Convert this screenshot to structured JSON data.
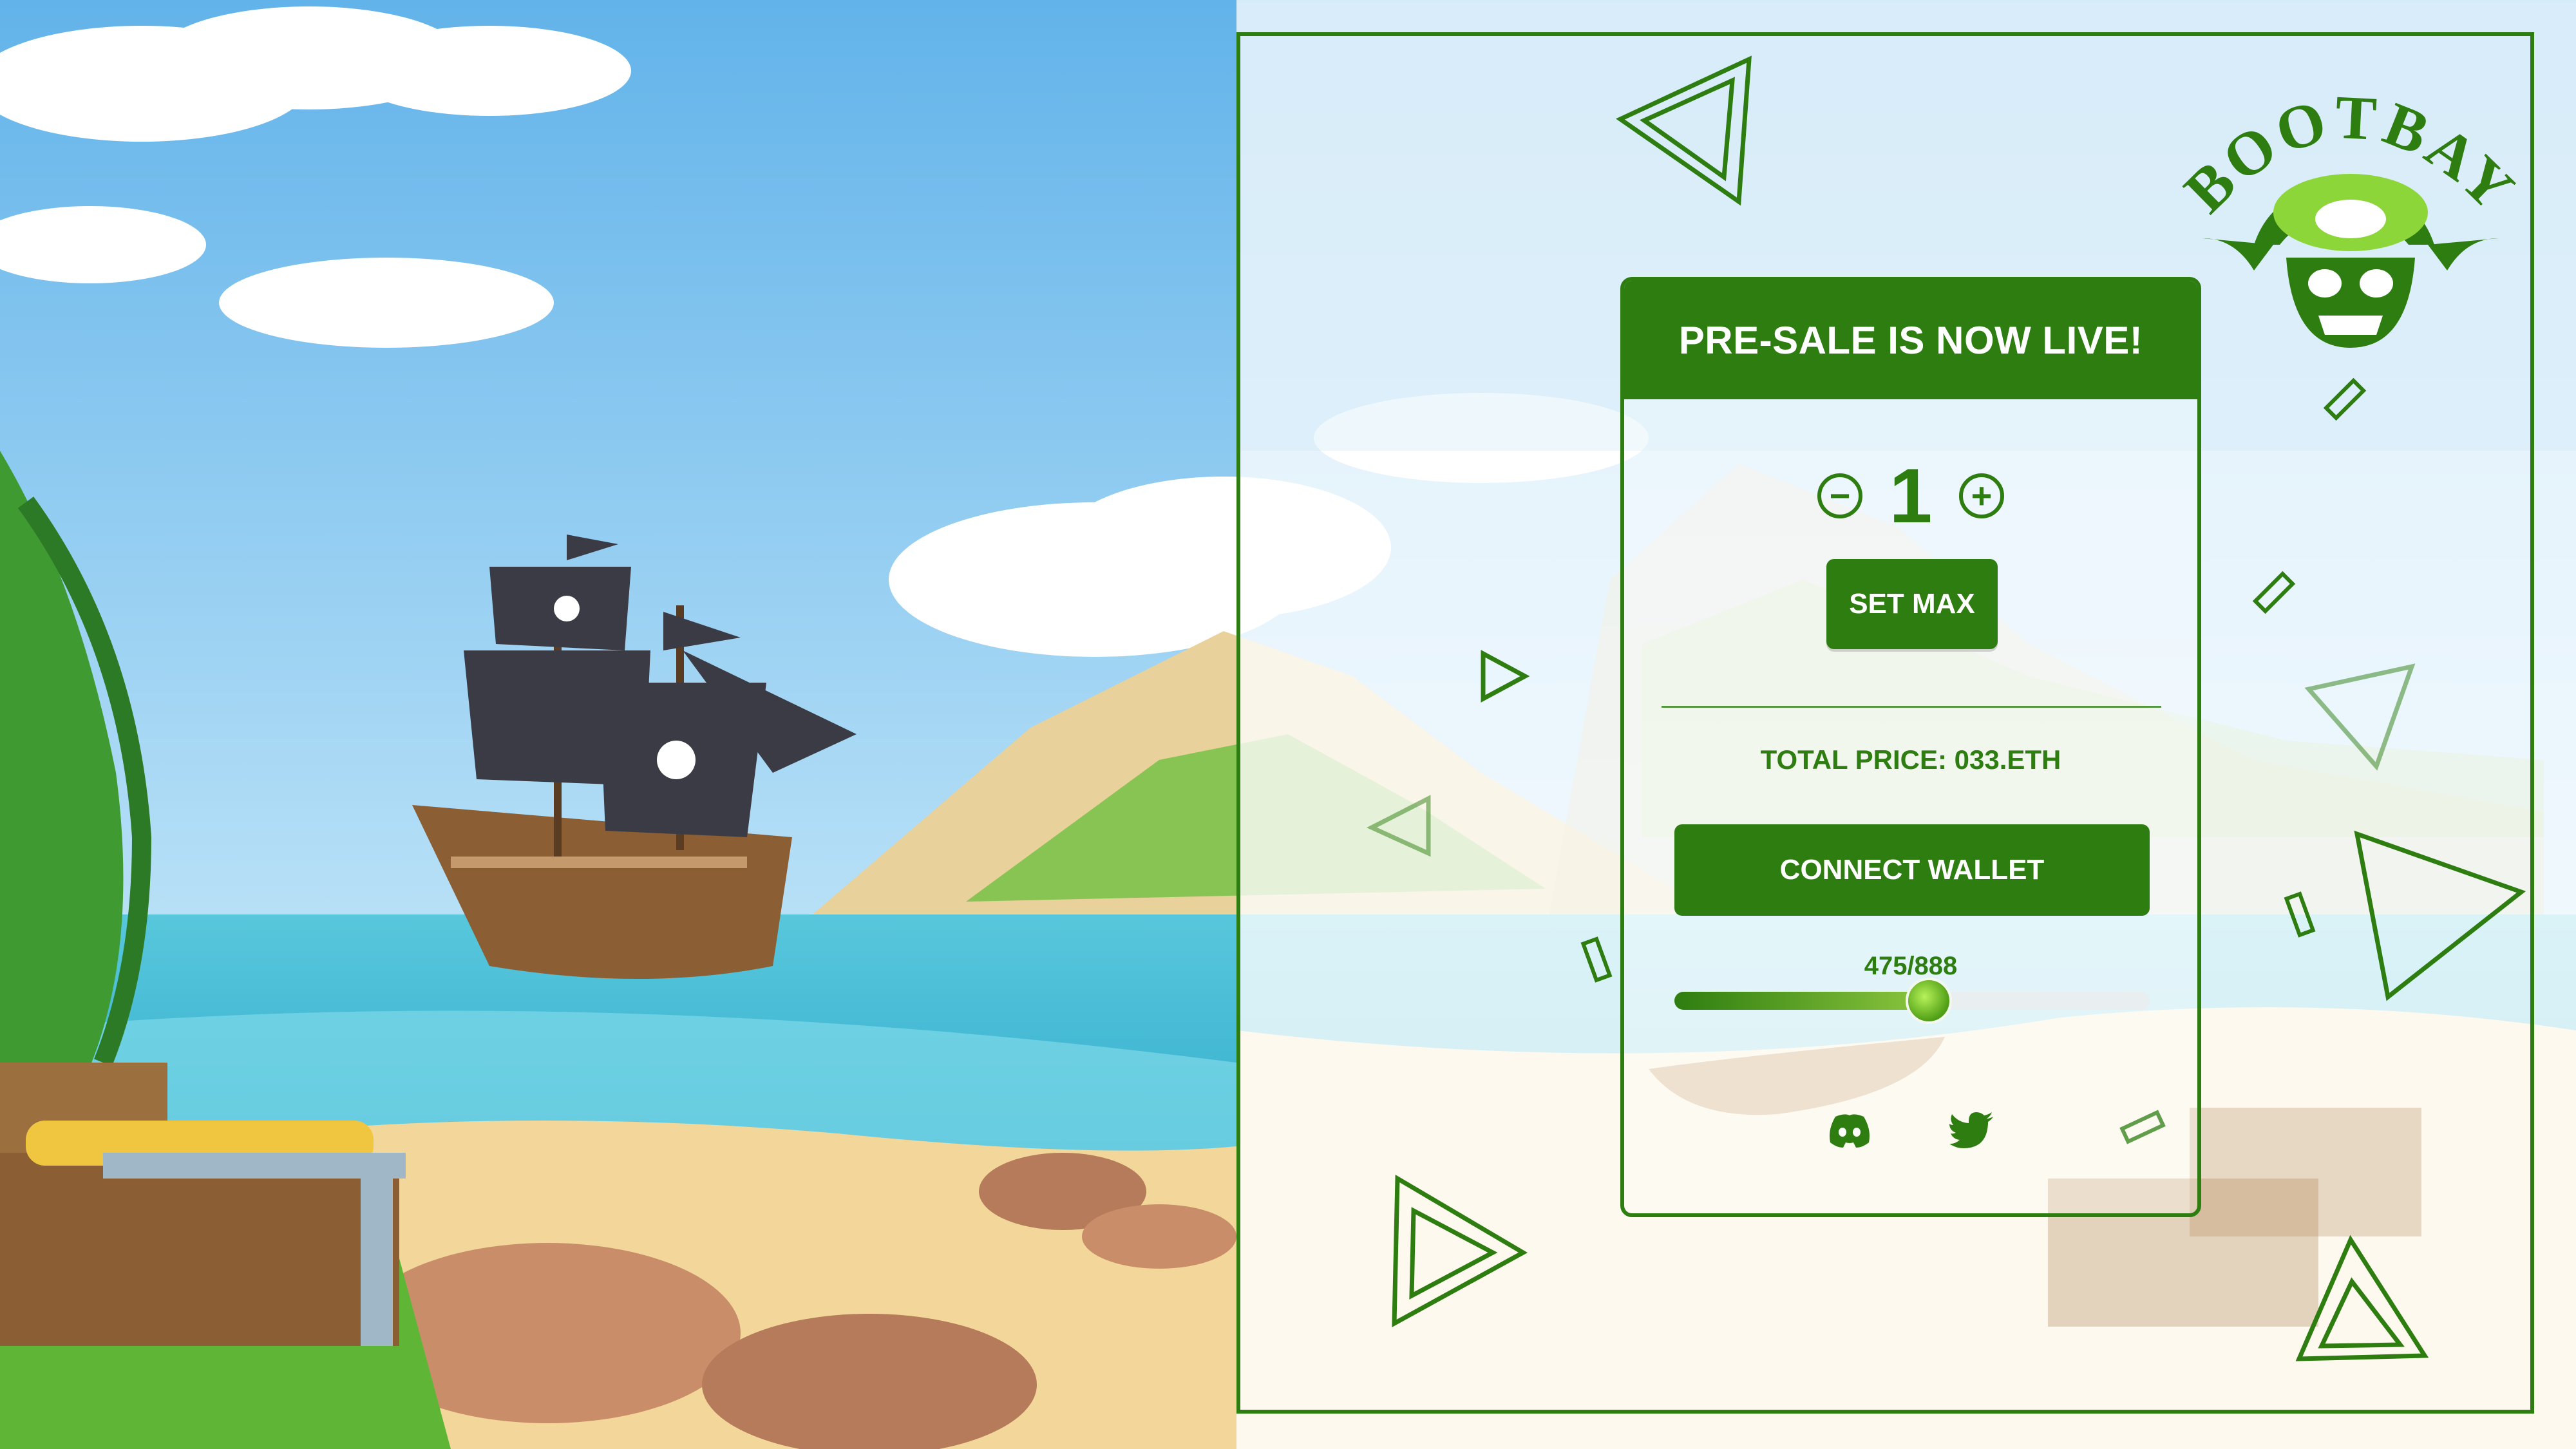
{
  "brand": {
    "name": "BOOTBAY"
  },
  "mint": {
    "header": "PRE-SALE IS NOW LIVE!",
    "quantity": "1",
    "decrement_symbol": "−",
    "increment_symbol": "+",
    "set_max_label": "SET MAX",
    "total_price_text": "TOTAL PRICE: 033.ETH",
    "connect_wallet_label": "CONNECT WALLET",
    "progress_text": "475/888",
    "progress": {
      "minted": 475,
      "supply": 888
    }
  },
  "socials": [
    {
      "name": "discord-icon"
    },
    {
      "name": "twitter-icon"
    }
  ],
  "colors": {
    "accent": "#2e7d10",
    "sky": "#67b9ec",
    "sea": "#4bc2da",
    "sand": "#f4dfa8"
  }
}
